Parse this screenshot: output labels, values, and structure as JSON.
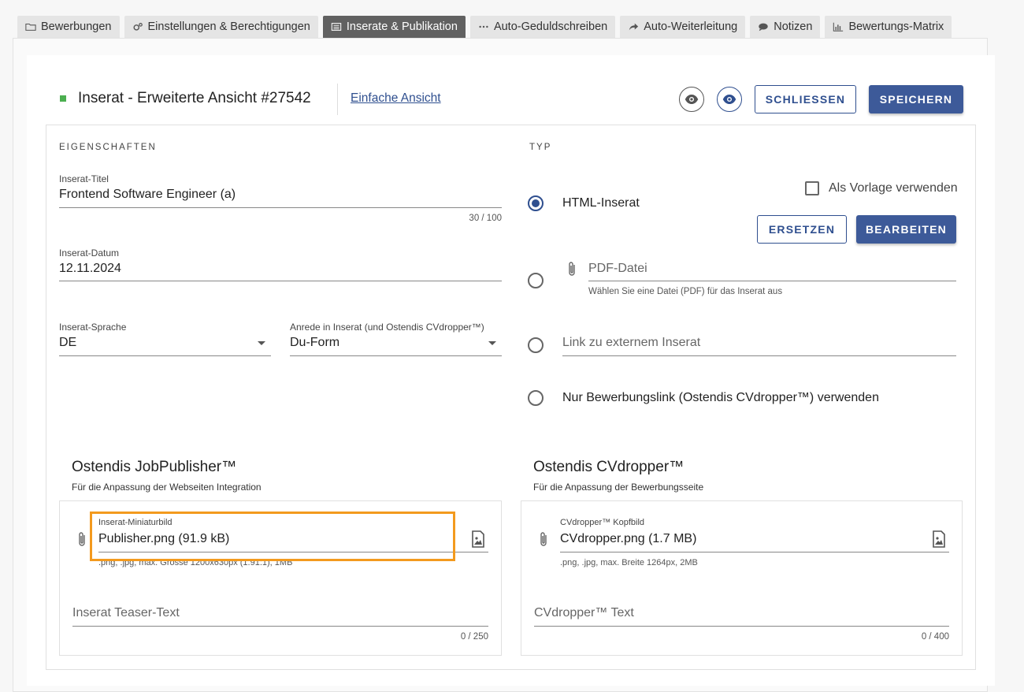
{
  "tabs": [
    {
      "label": "Bewerbungen",
      "icon": "folder-icon",
      "active": false
    },
    {
      "label": "Einstellungen & Berechtigungen",
      "icon": "gears-icon",
      "active": false
    },
    {
      "label": "Inserate & Publikation",
      "icon": "newspaper-icon",
      "active": true
    },
    {
      "label": "Auto-Geduldschreiben",
      "icon": "ellipsis-icon",
      "active": false
    },
    {
      "label": "Auto-Weiterleitung",
      "icon": "share-arrow-icon",
      "active": false
    },
    {
      "label": "Notizen",
      "icon": "comment-icon",
      "active": false
    },
    {
      "label": "Bewertungs-Matrix",
      "icon": "bar-chart-icon",
      "active": false
    }
  ],
  "header": {
    "title": "Inserat - Erweiterte Ansicht #27542",
    "simple_view_link": "Einfache Ansicht",
    "close_label": "SCHLIESSEN",
    "save_label": "SPEICHERN"
  },
  "properties": {
    "section_label": "EIGENSCHAFTEN",
    "title_label": "Inserat-Titel",
    "title_value": "Frontend Software Engineer (a)",
    "title_counter": "30 / 100",
    "date_label": "Inserat-Datum",
    "date_value": "12.11.2024",
    "language_label": "Inserat-Sprache",
    "language_value": "DE",
    "salutation_label": "Anrede in Inserat (und Ostendis CVdropper™)",
    "salutation_value": "Du-Form"
  },
  "type": {
    "section_label": "TYP",
    "template_label": "Als Vorlage verwenden",
    "html_label": "HTML-Inserat",
    "replace_label": "ERSETZEN",
    "edit_label": "BEARBEITEN",
    "pdf_placeholder": "PDF-Datei",
    "pdf_hint": "Wählen Sie eine Datei (PDF) für das Inserat aus",
    "link_placeholder": "Link zu externem Inserat",
    "applylink_label": "Nur Bewerbungslink (Ostendis CVdropper™) verwenden"
  },
  "jobpublisher": {
    "heading": "Ostendis JobPublisher™",
    "description": "Für die Anpassung der Webseiten Integration",
    "thumb_label": "Inserat-Miniaturbild",
    "thumb_value": "Publisher.png (91.9 kB)",
    "thumb_hint": ".png, .jpg, max. Grösse 1200x630px (1.91:1), 1MB",
    "teaser_placeholder": "Inserat Teaser-Text",
    "teaser_counter": "0 / 250"
  },
  "cvdropper": {
    "heading": "Ostendis CVdropper™",
    "description": "Für die Anpassung der Bewerbungsseite",
    "header_label": "CVdropper™ Kopfbild",
    "header_value": "CVdropper.png (1.7 MB)",
    "header_hint": ".png, .jpg, max. Breite 1264px, 2MB",
    "text_placeholder": "CVdropper™ Text",
    "text_counter": "0 / 400"
  },
  "colors": {
    "primary": "#3d5a99",
    "active_tab": "#616161",
    "highlight": "#f39a1e",
    "status_dot": "#4caf50"
  }
}
